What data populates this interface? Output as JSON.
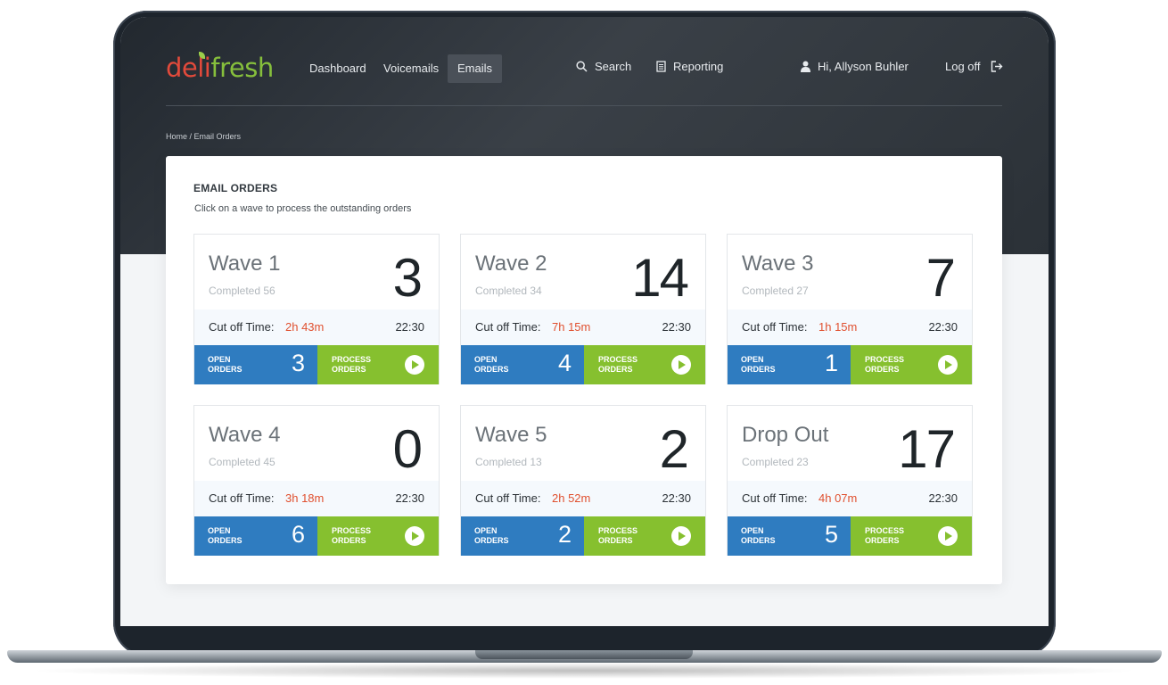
{
  "brand": {
    "logo_part1": "deli",
    "logo_part2": "fresh"
  },
  "nav": {
    "items": [
      {
        "label": "Dashboard"
      },
      {
        "label": "Voicemails"
      },
      {
        "label": "Emails",
        "active": true
      }
    ],
    "search": "Search",
    "reporting": "Reporting",
    "user": "Hi, Allyson Buhler",
    "logoff": "Log off"
  },
  "breadcrumb": "Home / Email Orders",
  "panel": {
    "title": "EMAIL ORDERS",
    "subtitle": "Click on a wave to process the outstanding orders"
  },
  "labels": {
    "cutoff": "Cut off Time:",
    "open_orders": "OPEN ORDERS",
    "process_orders": "PROCESS ORDERS"
  },
  "waves": [
    {
      "name": "Wave 1",
      "completed": "Completed 56",
      "count": "3",
      "remaining": "2h 43m",
      "cutoff": "22:30",
      "open": "3"
    },
    {
      "name": "Wave 2",
      "completed": "Completed 34",
      "count": "14",
      "remaining": "7h 15m",
      "cutoff": "22:30",
      "open": "4"
    },
    {
      "name": "Wave 3",
      "completed": "Completed 27",
      "count": "7",
      "remaining": "1h 15m",
      "cutoff": "22:30",
      "open": "1"
    },
    {
      "name": "Wave 4",
      "completed": "Completed 45",
      "count": "0",
      "remaining": "3h 18m",
      "cutoff": "22:30",
      "open": "6"
    },
    {
      "name": "Wave 5",
      "completed": "Completed 13",
      "count": "2",
      "remaining": "2h 52m",
      "cutoff": "22:30",
      "open": "2"
    },
    {
      "name": "Drop Out",
      "completed": "Completed 23",
      "count": "17",
      "remaining": "4h 07m",
      "cutoff": "22:30",
      "open": "5"
    }
  ],
  "colors": {
    "open_blue": "#2f7cc0",
    "process_green": "#86c02f",
    "remaining_red": "#e0502f"
  }
}
